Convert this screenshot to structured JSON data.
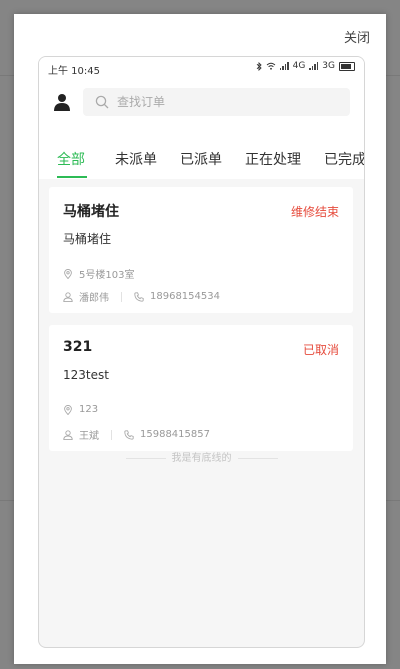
{
  "modal": {
    "close_label": "关闭"
  },
  "status_bar": {
    "time": "上午 10:45",
    "network_1": "4G",
    "network_2": "3G"
  },
  "search": {
    "placeholder": "查找订单"
  },
  "tabs": [
    {
      "label": "全部",
      "active": true
    },
    {
      "label": "未派单",
      "active": false
    },
    {
      "label": "已派单",
      "active": false
    },
    {
      "label": "正在处理",
      "active": false
    },
    {
      "label": "已完成",
      "active": false
    }
  ],
  "orders": [
    {
      "title": "马桶堵住",
      "status": "维修结束",
      "description": "马桶堵住",
      "address": "5号楼103室",
      "contact_name": "潘郎伟",
      "phone": "18968154534"
    },
    {
      "title": "321",
      "status": "已取消",
      "description": "123test",
      "address": "123",
      "contact_name": "王斌",
      "phone": "15988415857"
    }
  ],
  "list_footer": "我是有底线的",
  "colors": {
    "accent_green": "#2dbb55",
    "status_red": "#e64b3c"
  },
  "icons": {
    "user": "user-icon",
    "search": "search-icon",
    "location": "location-pin-icon",
    "person": "person-icon",
    "phone": "phone-icon",
    "bluetooth": "bluetooth-icon",
    "wifi": "wifi-icon",
    "battery": "battery-icon"
  }
}
